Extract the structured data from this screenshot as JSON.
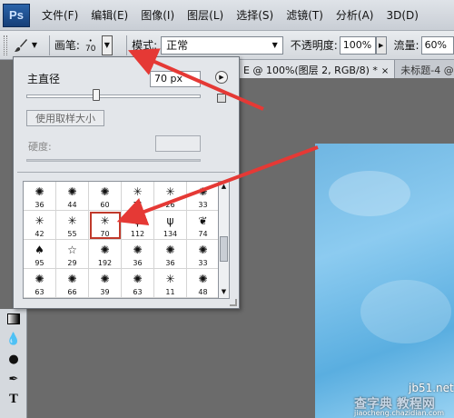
{
  "menubar": {
    "logo": "Ps",
    "items": [
      "文件(F)",
      "编辑(E)",
      "图像(I)",
      "图层(L)",
      "选择(S)",
      "滤镜(T)",
      "分析(A)",
      "3D(D)"
    ]
  },
  "options": {
    "brush_label": "画笔:",
    "brush_size": "70",
    "mode_label": "模式:",
    "mode_value": "正常",
    "opacity_label": "不透明度:",
    "opacity_value": "100%",
    "flow_label": "流量:",
    "flow_value": "60%"
  },
  "tabs": [
    {
      "label": "E @ 100%(图层 2, RGB/8) *",
      "close": "×"
    },
    {
      "label": "未标题-4 @ 1",
      "close": ""
    }
  ],
  "picker": {
    "diameter_label": "主直径",
    "diameter_value": "70 px",
    "diameter_fraction": 0.4,
    "sample_button": "使用取样大小",
    "hardness_label": "硬度:",
    "brushes": [
      {
        "size": "36",
        "icon": "splatter-icon"
      },
      {
        "size": "44",
        "icon": "splatter-icon"
      },
      {
        "size": "60",
        "icon": "splatter-icon"
      },
      {
        "size": "14",
        "icon": "star-burst-icon"
      },
      {
        "size": "26",
        "icon": "star-burst-icon"
      },
      {
        "size": "33",
        "icon": "splatter-icon"
      },
      {
        "size": "42",
        "icon": "star-burst-icon"
      },
      {
        "size": "55",
        "icon": "star-burst-icon"
      },
      {
        "size": "70",
        "icon": "star-burst-icon",
        "selected": true
      },
      {
        "size": "112",
        "icon": "grass-icon"
      },
      {
        "size": "134",
        "icon": "grass-icon"
      },
      {
        "size": "74",
        "icon": "leaf-icon"
      },
      {
        "size": "95",
        "icon": "leaf-outline-icon"
      },
      {
        "size": "29",
        "icon": "star-outline-icon"
      },
      {
        "size": "192",
        "icon": "splatter-icon"
      },
      {
        "size": "36",
        "icon": "splatter-icon"
      },
      {
        "size": "36",
        "icon": "splatter-icon"
      },
      {
        "size": "33",
        "icon": "splatter-icon"
      },
      {
        "size": "63",
        "icon": "splatter-icon"
      },
      {
        "size": "66",
        "icon": "splatter-icon"
      },
      {
        "size": "39",
        "icon": "splatter-icon"
      },
      {
        "size": "63",
        "icon": "splatter-icon"
      },
      {
        "size": "11",
        "icon": "star-burst-icon"
      },
      {
        "size": "48",
        "icon": "splatter-icon"
      }
    ]
  },
  "watermark": {
    "line1": "jb51.net",
    "line2": "查字典 教程网",
    "line3": "jiaocheng.chazidian.com"
  },
  "colors": {
    "highlight": "#c0392b",
    "arrow": "#e53935",
    "canvas": "#6fb6e2"
  }
}
